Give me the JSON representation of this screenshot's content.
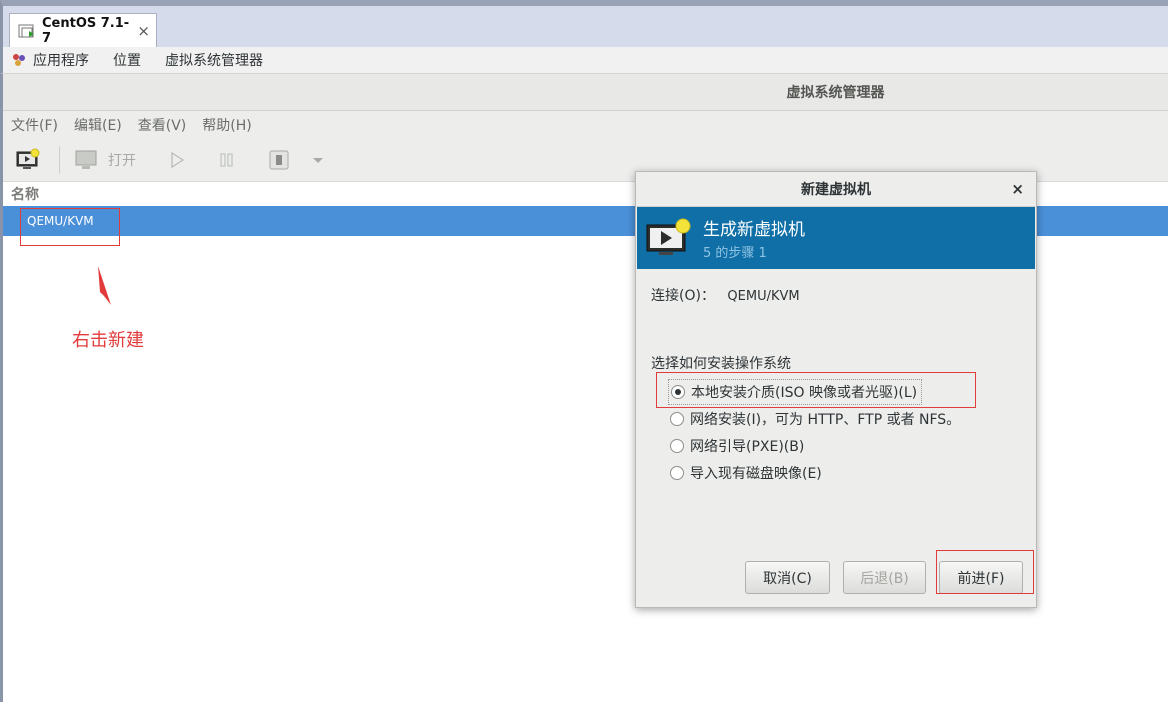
{
  "tab": {
    "title": "CentOS 7.1-7",
    "close": "×"
  },
  "gnome_panel": {
    "items": [
      "应用程序",
      "位置",
      "虚拟系统管理器"
    ]
  },
  "window": {
    "title": "虚拟系统管理器",
    "menu": [
      "文件(F)",
      "编辑(E)",
      "查看(V)",
      "帮助(H)"
    ],
    "toolbar": {
      "open_label": "打开"
    },
    "list_header": "名称",
    "rows": [
      "QEMU/KVM"
    ]
  },
  "annotation": {
    "text": "右击新建"
  },
  "dialog": {
    "title": "新建虚拟机",
    "close": "×",
    "banner_title": "生成新虚拟机",
    "banner_step": "5 的步骤 1",
    "connection_label": "连接(O)：",
    "connection_value": "QEMU/KVM",
    "section_label": "选择如何安装操作系统",
    "options": [
      {
        "label": "本地安装介质(ISO 映像或者光驱)(L)",
        "checked": true
      },
      {
        "label": "网络安装(I)，可为 HTTP、FTP 或者 NFS。",
        "checked": false
      },
      {
        "label": "网络引导(PXE)(B)",
        "checked": false
      },
      {
        "label": "导入现有磁盘映像(E)",
        "checked": false
      }
    ],
    "buttons": {
      "cancel": "取消(C)",
      "back": "后退(B)",
      "forward": "前进(F)"
    }
  },
  "colors": {
    "selection": "#4a90d9",
    "banner": "#0f6fa6",
    "annotation": "#e23b3b"
  }
}
